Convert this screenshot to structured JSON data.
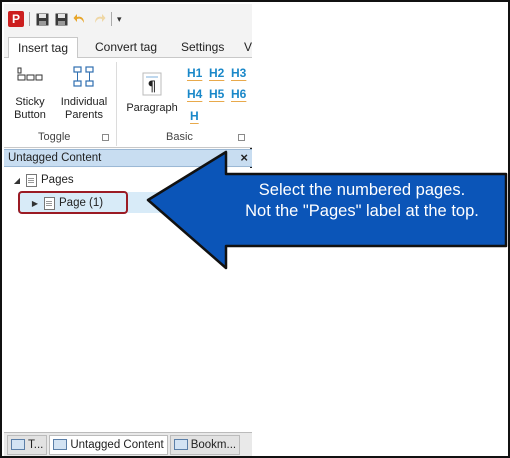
{
  "ribbon": {
    "tabs": [
      {
        "label": "Insert tag",
        "active": true
      },
      {
        "label": "Convert tag",
        "active": false
      },
      {
        "label": "Settings",
        "active": false
      },
      {
        "label": "V",
        "active": false
      }
    ],
    "toggle_group": {
      "label": "Toggle",
      "buttons": [
        "Sticky Button",
        "Individual Parents"
      ]
    },
    "basic_group": {
      "label": "Basic",
      "paragraph_label": "Paragraph",
      "headings": [
        "H1",
        "H2",
        "H3",
        "H4",
        "H5",
        "H6",
        "H"
      ]
    }
  },
  "panel": {
    "title": "Untagged Content",
    "close_glyph": "×",
    "tree": {
      "root_label": "Pages",
      "child_label": "Page (1)"
    }
  },
  "bottom_tabs": [
    "T...",
    "Untagged Content",
    "Bookm..."
  ],
  "callout": {
    "line1": "Select the numbered pages.",
    "line2": "Not the \"Pages\" label at the top.",
    "fill_color": "#0b55b8",
    "highlight_color": "#9b1b24"
  },
  "icons": {
    "app": "app-logo-icon",
    "save": "save-icon",
    "save_as": "save-as-icon",
    "undo": "undo-icon",
    "redo": "redo-icon",
    "customize": "dropdown-arrow-icon"
  }
}
